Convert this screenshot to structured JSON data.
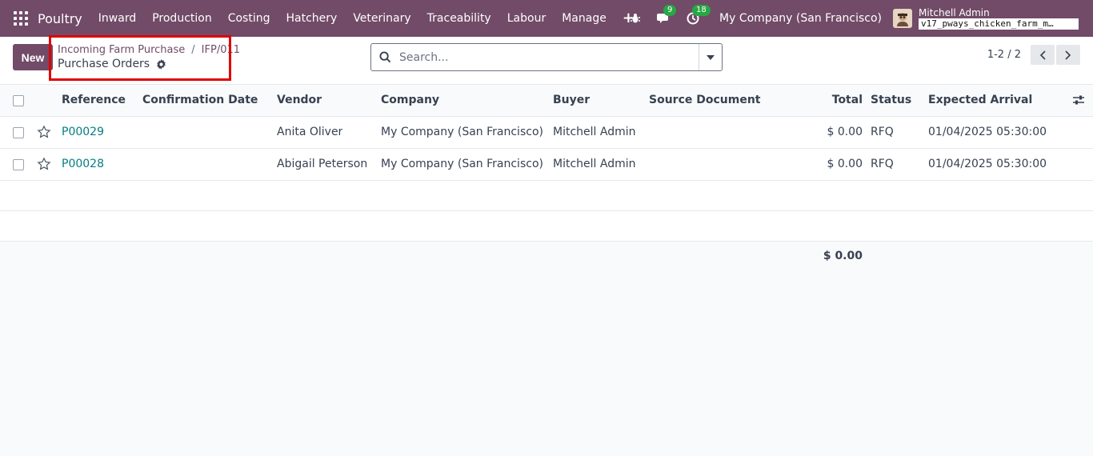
{
  "navbar": {
    "brand": "Poultry",
    "menu": [
      "Inward",
      "Production",
      "Costing",
      "Hatchery",
      "Veterinary",
      "Traceability",
      "Labour",
      "Manage"
    ],
    "plus": "+",
    "messages_count": "9",
    "activities_count": "18",
    "company": "My Company (San Francisco)",
    "user_name": "Mitchell Admin",
    "db_name": "v17_pways_chicken_farm_m…"
  },
  "control": {
    "new_label": "New",
    "breadcrumb": [
      "Incoming Farm Purchase",
      "IFP/011"
    ],
    "breadcrumb_sep": "/",
    "page_title": "Purchase Orders",
    "search_placeholder": "Search...",
    "pager": "1-2 / 2"
  },
  "table": {
    "columns": {
      "reference": "Reference",
      "confirmation_date": "Confirmation Date",
      "vendor": "Vendor",
      "company": "Company",
      "buyer": "Buyer",
      "source_document": "Source Document",
      "total": "Total",
      "status": "Status",
      "expected_arrival": "Expected Arrival"
    },
    "rows": [
      {
        "reference": "P00029",
        "confirmation_date": "",
        "vendor": "Anita Oliver",
        "company": "My Company (San Francisco)",
        "buyer": "Mitchell Admin",
        "source_document": "",
        "total": "$ 0.00",
        "status": "RFQ",
        "expected_arrival": "01/04/2025 05:30:00"
      },
      {
        "reference": "P00028",
        "confirmation_date": "",
        "vendor": "Abigail Peterson",
        "company": "My Company (San Francisco)",
        "buyer": "Mitchell Admin",
        "source_document": "",
        "total": "$ 0.00",
        "status": "RFQ",
        "expected_arrival": "01/04/2025 05:30:00"
      }
    ],
    "footer_total": "$ 0.00"
  },
  "colors": {
    "brand": "#714b67",
    "link": "#017e84",
    "badge": "#28a745",
    "highlight": "#e00000"
  }
}
